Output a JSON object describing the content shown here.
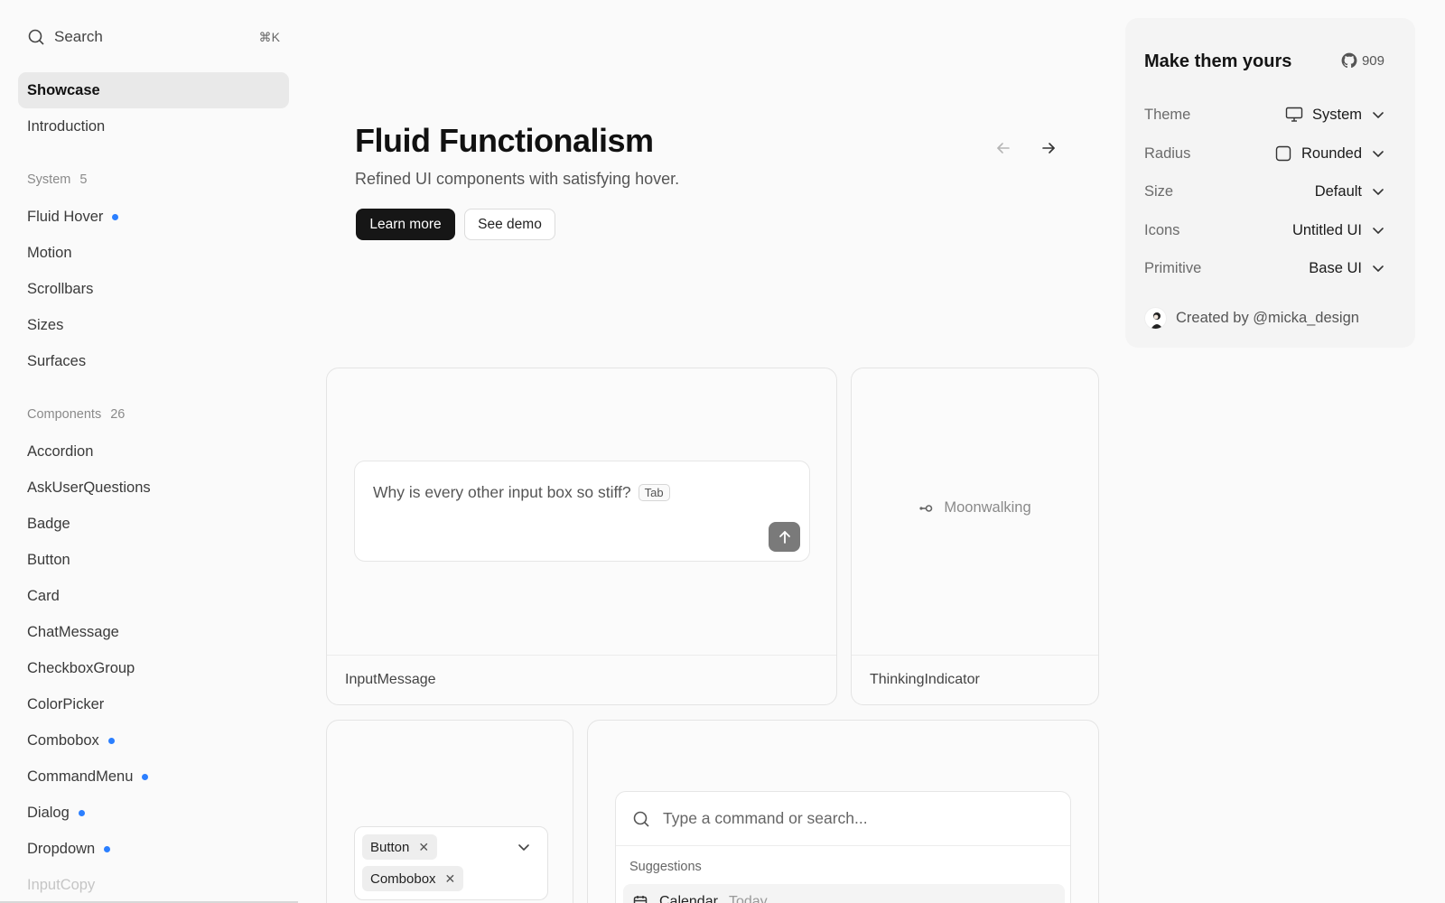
{
  "sidebar": {
    "search": {
      "label": "Search",
      "shortcut": "⌘K"
    },
    "showcase": "Showcase",
    "introduction": "Introduction",
    "system": {
      "title": "System",
      "count": "5",
      "items": [
        "Fluid Hover",
        "Motion",
        "Scrollbars",
        "Sizes",
        "Surfaces"
      ]
    },
    "components": {
      "title": "Components",
      "count": "26",
      "items": [
        "Accordion",
        "AskUserQuestions",
        "Badge",
        "Button",
        "Card",
        "ChatMessage",
        "CheckboxGroup",
        "ColorPicker",
        "Combobox",
        "CommandMenu",
        "Dialog",
        "Dropdown",
        "InputCopy"
      ]
    },
    "badge_color": "#2b7fff"
  },
  "hero": {
    "title": "Fluid Functionalism",
    "subtitle": "Refined UI components with satisfying hover.",
    "primary_button": "Learn more",
    "secondary_button": "See demo"
  },
  "cards": {
    "input_message": {
      "placeholder": "Why is every other input box so stiff?",
      "tab_hint": "Tab",
      "caption": "InputMessage"
    },
    "thinking_indicator": {
      "text": "Moonwalking",
      "caption": "ThinkingIndicator"
    },
    "combobox": {
      "chips": [
        "Button",
        "Combobox"
      ]
    },
    "command_menu": {
      "placeholder": "Type a command or search...",
      "group": "Suggestions",
      "item": "Calendar",
      "item_hint": "Today"
    }
  },
  "panel": {
    "title": "Make them yours",
    "stars": "909",
    "settings": [
      {
        "label": "Theme",
        "value": "System",
        "icon": "monitor-icon"
      },
      {
        "label": "Radius",
        "value": "Rounded",
        "icon": "square-icon"
      },
      {
        "label": "Size",
        "value": "Default"
      },
      {
        "label": "Icons",
        "value": "Untitled UI"
      },
      {
        "label": "Primitive",
        "value": "Base UI"
      }
    ],
    "credit": "Created by @micka_design"
  }
}
